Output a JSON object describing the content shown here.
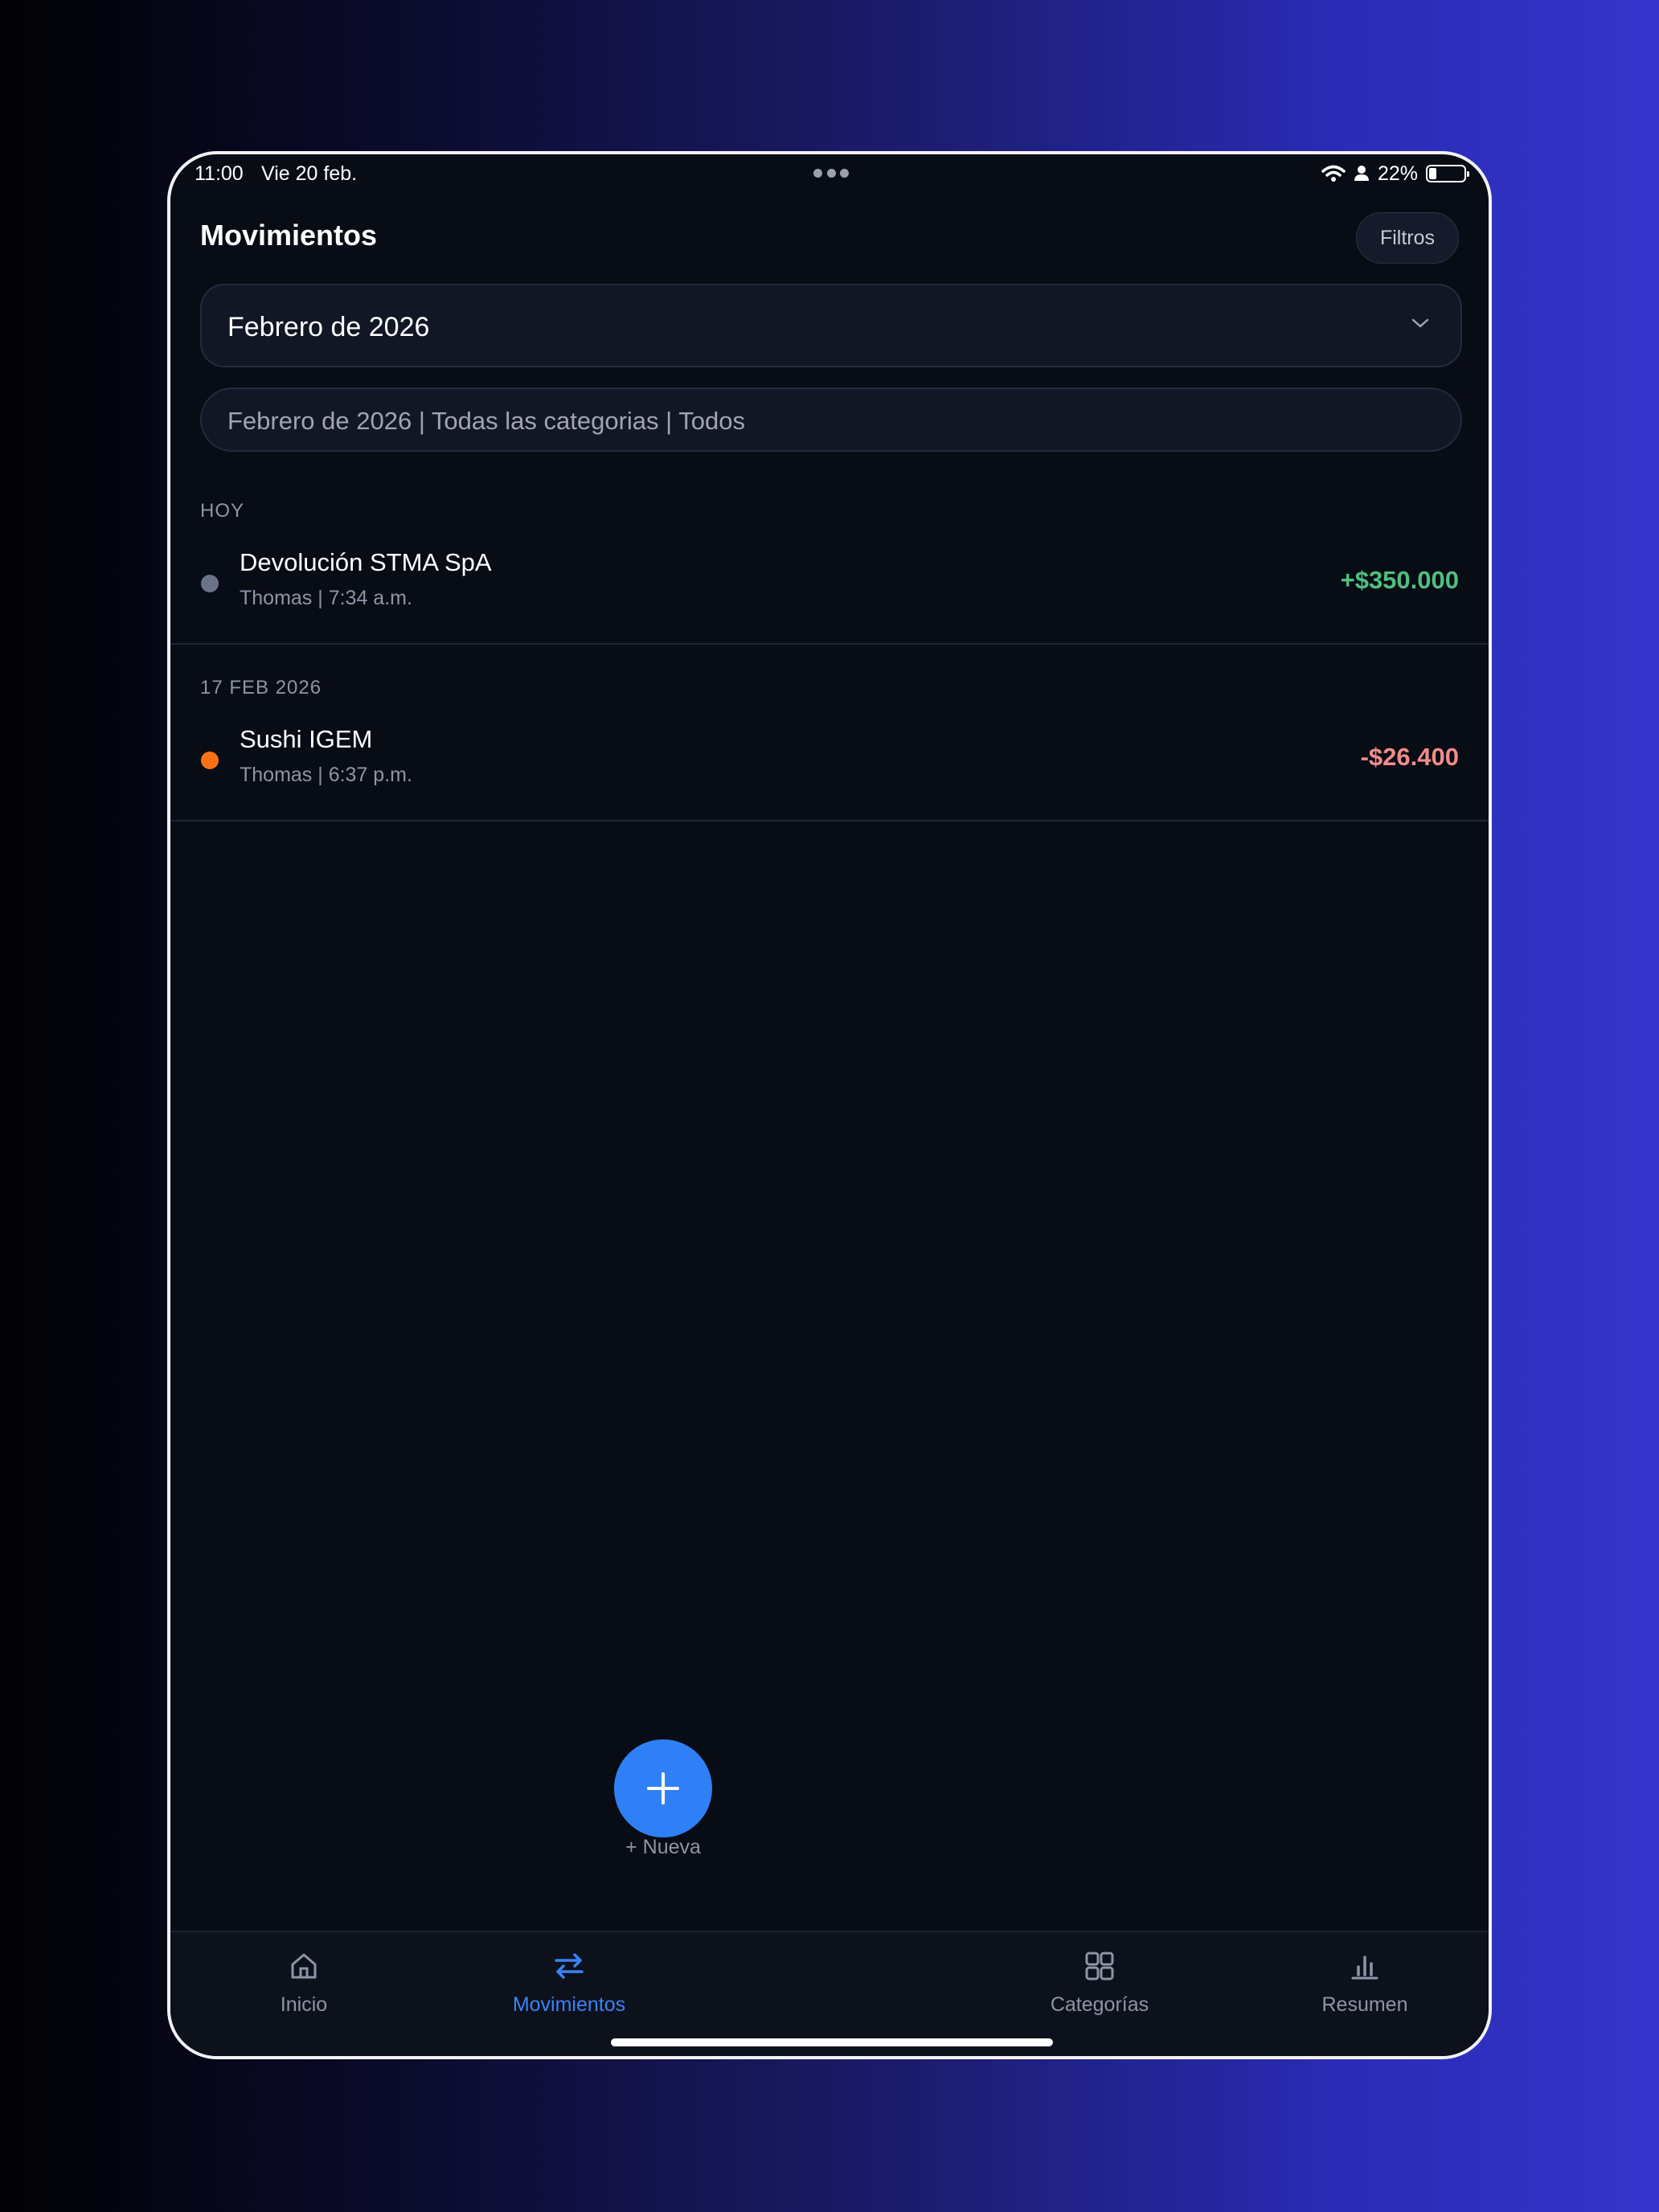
{
  "status_bar": {
    "time": "11:00",
    "date": "Vie 20 feb.",
    "battery": "22%"
  },
  "header": {
    "title": "Movimientos",
    "filter_label": "Filtros"
  },
  "month_select": {
    "value": "Febrero de 2026"
  },
  "summary": {
    "text": "Febrero de 2026 | Todas las categorias | Todos"
  },
  "sections": [
    {
      "label": "HOY",
      "transactions": [
        {
          "title": "Devolución STMA SpA",
          "subtitle": "Thomas | 7:34 a.m.",
          "amount": "+$350.000",
          "amount_color": "#4fbf7f",
          "dot_color": "#6b7388"
        }
      ]
    },
    {
      "label": "17 FEB 2026",
      "transactions": [
        {
          "title": "Sushi IGEM",
          "subtitle": "Thomas | 6:37 p.m.",
          "amount": "-$26.400",
          "amount_color": "#f28c8c",
          "dot_color": "#f97316"
        }
      ]
    }
  ],
  "tabbar": {
    "items": [
      {
        "label": "Inicio",
        "icon": "home-icon"
      },
      {
        "label": "Movimientos",
        "icon": "transfer-icon"
      },
      {
        "label": "+ Nueva",
        "icon": "plus-icon"
      },
      {
        "label": "Categorías",
        "icon": "grid-icon"
      },
      {
        "label": "Resumen",
        "icon": "bar-chart-icon"
      }
    ],
    "active": "Movimientos"
  },
  "colors": {
    "accent": "#2f80f6",
    "background": "#080c15"
  }
}
